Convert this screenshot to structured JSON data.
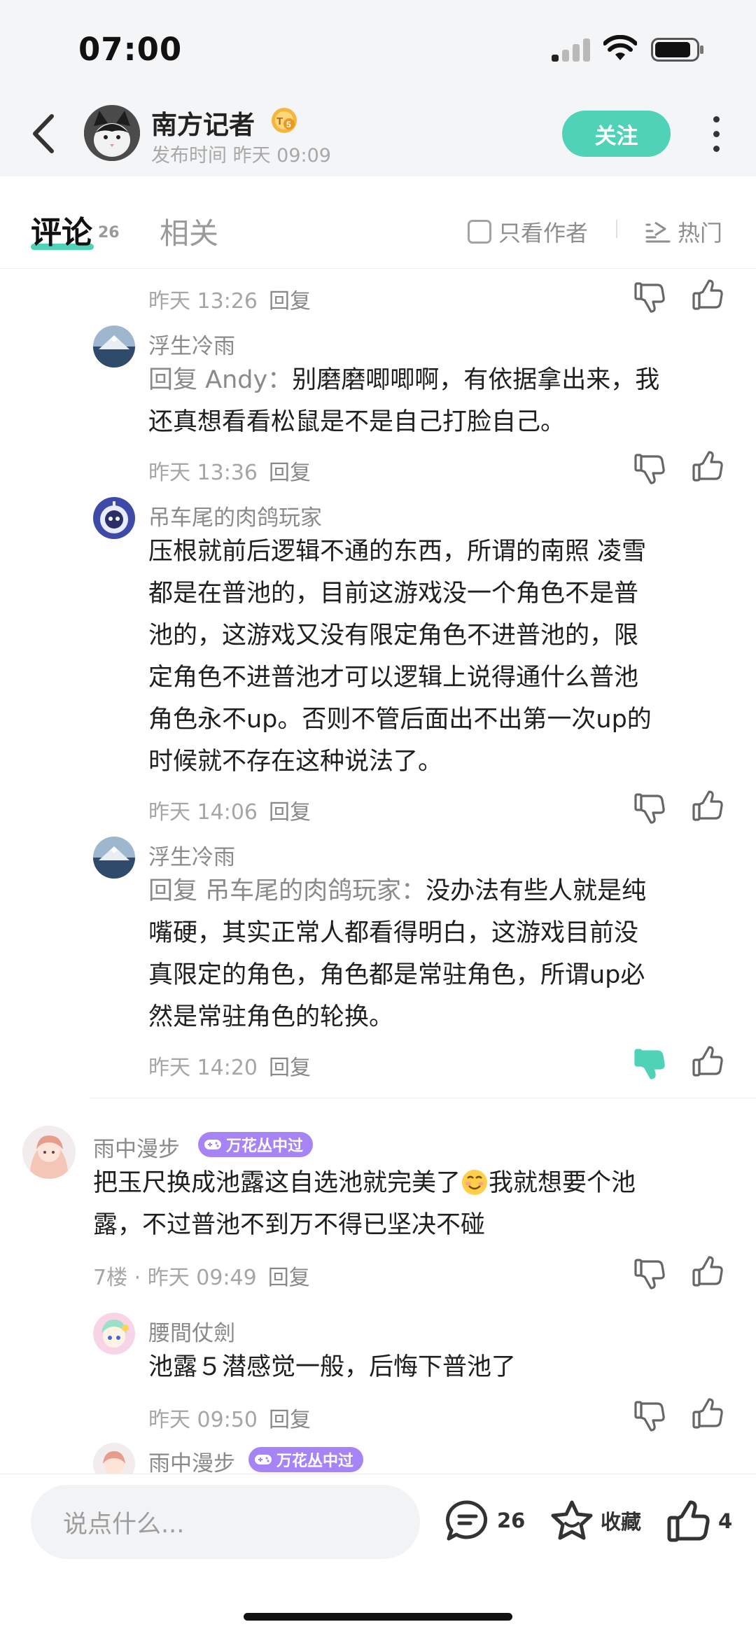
{
  "status_bar": {
    "time": "07:00"
  },
  "header": {
    "author": "南方记者",
    "badge": "T5",
    "publish_time": "发布时间 昨天 09:09",
    "follow_label": "关注"
  },
  "tabs": {
    "comment_label": "评论",
    "comment_count": "26",
    "related_label": "相关",
    "author_only_label": "只看作者",
    "sort_label": "热门"
  },
  "comments": {
    "c0": {
      "time": "昨天 13:26",
      "reply_label": "回复"
    },
    "c1": {
      "user": "浮生冷雨",
      "reply_prefix": "回复 Andy：",
      "line1": "别磨磨唧唧啊，有依据拿出来，我",
      "line2": "还真想看看松鼠是不是自己打脸自己。",
      "time": "昨天 13:36",
      "reply_label": "回复"
    },
    "c2": {
      "user": "吊车尾的肉鸽玩家",
      "lines": [
        "压根就前后逻辑不通的东西，所谓的南照 凌雪",
        "都是在普池的，目前这游戏没一个角色不是普",
        "池的，这游戏又没有限定角色不进普池的，限",
        "定角色不进普池才可以逻辑上说得通什么普池",
        "角色永不up。否则不管后面出不出第一次up的",
        "时候就不存在这种说法了。"
      ],
      "time": "昨天 14:06",
      "reply_label": "回复"
    },
    "c3": {
      "user": "浮生冷雨",
      "reply_prefix": "回复 吊车尾的肉鸽玩家：",
      "line1": "没办法有些人就是纯",
      "line2": "嘴硬，其实正常人都看得明白，这游戏目前没",
      "line3": "真限定的角色，角色都是常驻角色，所谓up必",
      "line4": "然是常驻角色的轮换。",
      "time": "昨天 14:20",
      "reply_label": "回复"
    },
    "c4": {
      "user": "雨中漫步",
      "tag": "万花丛中过",
      "line1a": "把玉尺换成池露这自选池就完美了",
      "line1b": "我就想要个池",
      "line2": "露，不过普池不到万不得已坚决不碰",
      "time": "7楼 · 昨天 09:49",
      "reply_label": "回复"
    },
    "c5": {
      "user": "腰間仗劍",
      "line1": "池露５潜感觉一般，后悔下普池了",
      "time": "昨天 09:50",
      "reply_label": "回复"
    },
    "c6": {
      "user": "雨中漫步",
      "tag": "万花丛中过"
    }
  },
  "bottom_bar": {
    "placeholder": "说点什么...",
    "comment_count": "26",
    "favorite_label": "收藏",
    "like_count": "4"
  },
  "colors": {
    "accent": "#4fd2b6",
    "tag_purple": "#a784f5",
    "muted": "#a6a6a6"
  }
}
